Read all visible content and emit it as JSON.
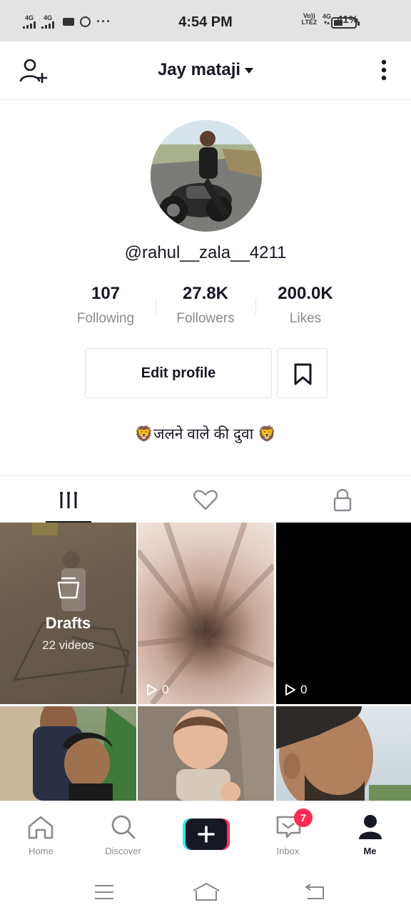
{
  "status_bar": {
    "sim1": "4G",
    "sim2": "4G",
    "time": "4:54 PM",
    "volte": "Vo))",
    "lte": "LTE2",
    "net": "4G",
    "battery": "41%",
    "battery_level": 0.41
  },
  "header": {
    "title": "Jay mataji",
    "add_user_icon": "add-user-icon",
    "more_icon": "more-vertical-icon"
  },
  "profile": {
    "username": "@rahul__zala__4211",
    "stats": [
      {
        "value": "107",
        "label": "Following"
      },
      {
        "value": "27.8K",
        "label": "Followers"
      },
      {
        "value": "200.0K",
        "label": "Likes"
      }
    ],
    "edit_button": "Edit profile",
    "bio": "🦁जलने वाले की दुवा 🦁"
  },
  "tabs": [
    {
      "icon": "grid-icon",
      "active": true
    },
    {
      "icon": "heart-icon",
      "active": false
    },
    {
      "icon": "lock-icon",
      "active": false
    }
  ],
  "grid": {
    "drafts": {
      "title": "Drafts",
      "count": "22 videos"
    },
    "videos": [
      {
        "views": "0"
      },
      {
        "views": "0"
      }
    ]
  },
  "bottom_nav": {
    "items": [
      {
        "label": "Home",
        "icon": "home-icon"
      },
      {
        "label": "Discover",
        "icon": "search-icon"
      },
      {
        "label": "",
        "icon": "plus-icon"
      },
      {
        "label": "Inbox",
        "icon": "inbox-icon",
        "badge": "7"
      },
      {
        "label": "Me",
        "icon": "person-icon"
      }
    ]
  },
  "colors": {
    "accent_red": "#fe2c55",
    "accent_cyan": "#25f4ee",
    "text": "#161823",
    "muted": "#8a8b91"
  }
}
